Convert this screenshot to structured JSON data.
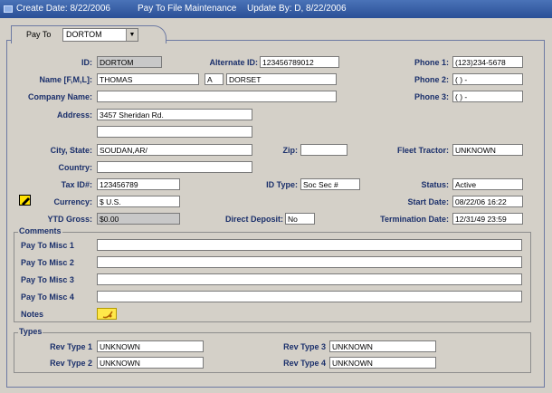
{
  "window": {
    "create_date": "Create Date: 8/22/2006",
    "title": "Pay To File Maintenance",
    "update_by": "Update By: D, 8/22/2006"
  },
  "payto_tab": {
    "label": "Pay To",
    "selected": "DORTOM"
  },
  "labels": {
    "id": "ID:",
    "alt_id": "Alternate ID:",
    "phone1": "Phone 1:",
    "name": "Name [F,M,L]:",
    "phone2": "Phone 2:",
    "company": "Company Name:",
    "phone3": "Phone 3:",
    "address": "Address:",
    "city_state": "City, State:",
    "zip": "Zip:",
    "fleet_tractor": "Fleet Tractor:",
    "country": "Country:",
    "tax_id": "Tax ID#:",
    "id_type": "ID Type:",
    "status": "Status:",
    "currency": "Currency:",
    "start_date": "Start Date:",
    "ytd_gross": "YTD Gross:",
    "direct_deposit": "Direct Deposit:",
    "termination_date": "Termination Date:"
  },
  "values": {
    "id": "DORTOM",
    "alt_id": "123456789012",
    "phone1": "(123)234-5678",
    "first_name": "THOMAS",
    "middle": "A",
    "last_name": "DORSET",
    "phone2": "(  )  -",
    "company": "",
    "phone3": "(  )  -",
    "address1": "3457 Sheridan Rd.",
    "address2": "",
    "city_state": "SOUDAN,AR/",
    "zip": "",
    "fleet_tractor": "UNKNOWN",
    "country": "",
    "tax_id": "123456789",
    "id_type": "Soc Sec #",
    "status": "Active",
    "currency": "$ U.S.",
    "start_date": "08/22/06 16:22",
    "ytd_gross": "$0.00",
    "direct_deposit": "No",
    "termination_date": "12/31/49 23:59"
  },
  "comments": {
    "legend": "Comments",
    "misc1": "Pay To Misc 1",
    "misc2": "Pay To Misc 2",
    "misc3": "Pay To Misc 3",
    "misc4": "Pay To Misc 4",
    "notes": "Notes"
  },
  "types": {
    "legend": "Types",
    "rev1_label": "Rev Type 1",
    "rev1": "UNKNOWN",
    "rev2_label": "Rev Type 2",
    "rev2": "UNKNOWN",
    "rev3_label": "Rev Type 3",
    "rev3": "UNKNOWN",
    "rev4_label": "Rev Type 4",
    "rev4": "UNKNOWN"
  },
  "icons": {
    "window": "window-icon",
    "currency": "edit-note-icon",
    "notes": "note-icon"
  }
}
